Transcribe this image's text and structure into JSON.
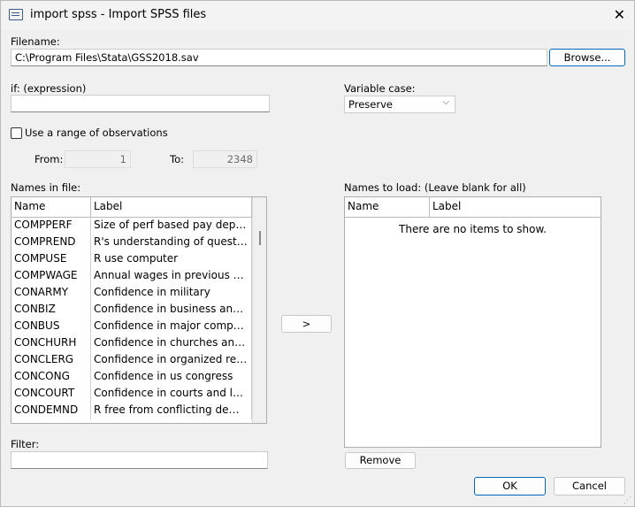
{
  "window": {
    "title": "import spss - Import SPSS files",
    "close": "✕"
  },
  "filename": {
    "label": "Filename:",
    "value": "C:\\Program Files\\Stata\\GSS2018.sav",
    "browse": "Browse..."
  },
  "if": {
    "label": "if: (expression)",
    "value": ""
  },
  "variable_case": {
    "label": "Variable case:",
    "selected": "Preserve"
  },
  "range": {
    "checkbox_label": "Use a range of observations",
    "checked": false,
    "from_label": "From:",
    "from": "1",
    "to_label": "To:",
    "to": "2348"
  },
  "names_in_file": {
    "label": "Names in file:",
    "columns": [
      "Name",
      "Label"
    ],
    "rows": [
      [
        "COMPPERF",
        "Size of perf based pay depend o..."
      ],
      [
        "COMPREND",
        "R's understanding of questions"
      ],
      [
        "COMPUSE",
        "R use computer"
      ],
      [
        "COMPWAGE",
        "Annual wages in previous year ..."
      ],
      [
        "CONARMY",
        "Confidence in military"
      ],
      [
        "CONBIZ",
        "Confidence in business and ind..."
      ],
      [
        "CONBUS",
        "Confidence in major companies"
      ],
      [
        "CONCHURH",
        "Confidence in churches and reli..."
      ],
      [
        "CONCLERG",
        "Confidence in organized religion"
      ],
      [
        "CONCONG",
        "Confidence in us congress"
      ],
      [
        "CONCOURT",
        "Confidence in courts and legal s..."
      ],
      [
        "CONDEMND",
        "R free from conflicting demands"
      ]
    ]
  },
  "add_button": ">",
  "names_to_load": {
    "label": "Names to load: (Leave blank for all)",
    "columns": [
      "Name",
      "Label"
    ],
    "empty": "There are no items to show.",
    "remove": "Remove"
  },
  "filter": {
    "label": "Filter:",
    "value": ""
  },
  "footer": {
    "ok": "OK",
    "cancel": "Cancel"
  }
}
